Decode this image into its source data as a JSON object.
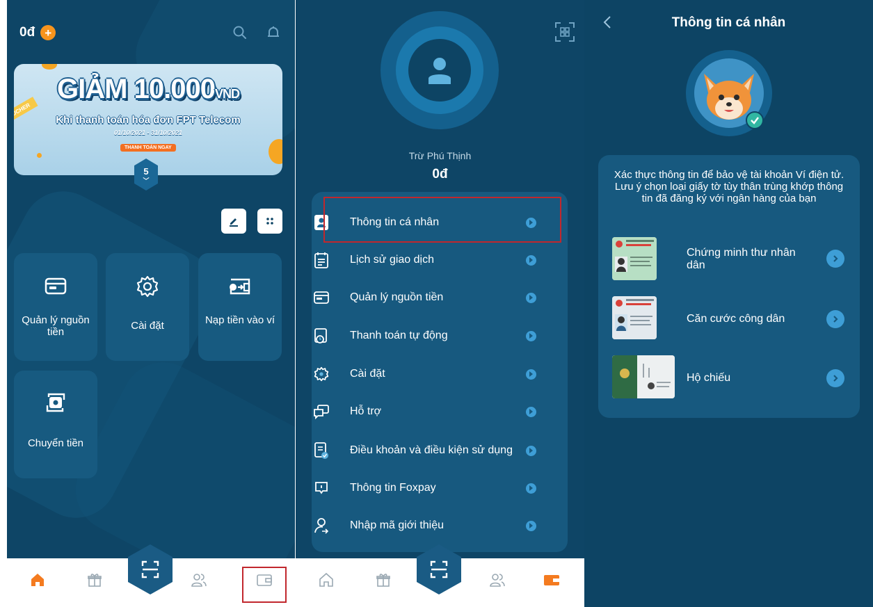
{
  "home": {
    "balance": "0đ",
    "plus": "+",
    "banner": {
      "headline": "GIẢM 10.000",
      "headline_unit": "VND",
      "subtitle": "Khi thanh toán hóa đơn FPT Telecom",
      "dates": "01/10/2021 - 31/10/2021",
      "cta": "THANH TOÁN NGAY",
      "voucher_tag": "UCHER"
    },
    "page_count": "5",
    "tiles": [
      {
        "label": "Quản lý nguồn tiền",
        "icon": "wallet-card-icon"
      },
      {
        "label": "Cài đặt",
        "icon": "gear-icon"
      },
      {
        "label": "Nạp tiền vào ví",
        "icon": "topup-icon"
      },
      {
        "label": "Chuyển tiền",
        "icon": "transfer-icon"
      }
    ]
  },
  "profile": {
    "name": "Trừ Phú Thịnh",
    "balance": "0đ",
    "menu": [
      {
        "label": "Thông tin cá nhân",
        "icon": "id-card-icon"
      },
      {
        "label": "Lịch sử giao dịch",
        "icon": "calendar-list-icon"
      },
      {
        "label": "Quản lý nguồn tiền",
        "icon": "wallet-card-icon"
      },
      {
        "label": "Thanh toán tự động",
        "icon": "auto-pay-icon"
      },
      {
        "label": "Cài đặt",
        "icon": "gear-icon"
      },
      {
        "label": "Hỗ trợ",
        "icon": "support-chat-icon"
      },
      {
        "label": "Điều khoản và điều kiện sử dụng",
        "icon": "terms-doc-icon"
      },
      {
        "label": "Thông tin Foxpay",
        "icon": "info-icon"
      },
      {
        "label": "Nhập mã giới thiệu",
        "icon": "referral-icon"
      }
    ]
  },
  "personal_info": {
    "title": "Thông tin cá nhân",
    "intro": "Xác thực thông tin để bảo vệ tài khoản Ví điện tử. Lưu ý chọn loại giấy tờ tùy thân trùng khớp thông tin đã đăng ký với ngân hàng của bạn",
    "documents": [
      {
        "label": "Chứng minh thư nhân dân"
      },
      {
        "label": "Căn cước công dân"
      },
      {
        "label": "Hộ chiếu"
      }
    ]
  },
  "colors": {
    "background": "#0e4566",
    "panel": "#17597f",
    "accent_orange": "#f7941d",
    "highlight_red": "#c1272d",
    "arrow_blue": "#3e9ed6"
  }
}
